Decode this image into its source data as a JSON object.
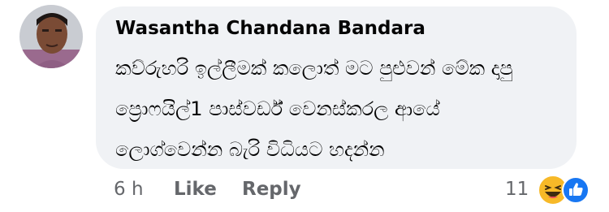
{
  "comment": {
    "author": "Wasantha Chandana Bandara",
    "lines": [
      "කව්රුහරි ඉල්ලීමක් කලොත් මට පුළුවන් මේක දාපු",
      "ප්‍රොෆයිල්1 පාස්වර්ඩ් වෙනස්කරල ආයේ",
      "ලොග්වෙන්න බැරි විධියට හදන්න"
    ],
    "time": "6 h",
    "like_label": "Like",
    "reply_label": "Reply",
    "reaction_count": "11",
    "reactions": [
      "haha-icon",
      "like-icon"
    ]
  },
  "colors": {
    "bubble": "#f0f2f5",
    "text": "#050505",
    "meta": "#65676b",
    "like_blue": "#1877f2",
    "haha_yellow": "#f7b928"
  }
}
